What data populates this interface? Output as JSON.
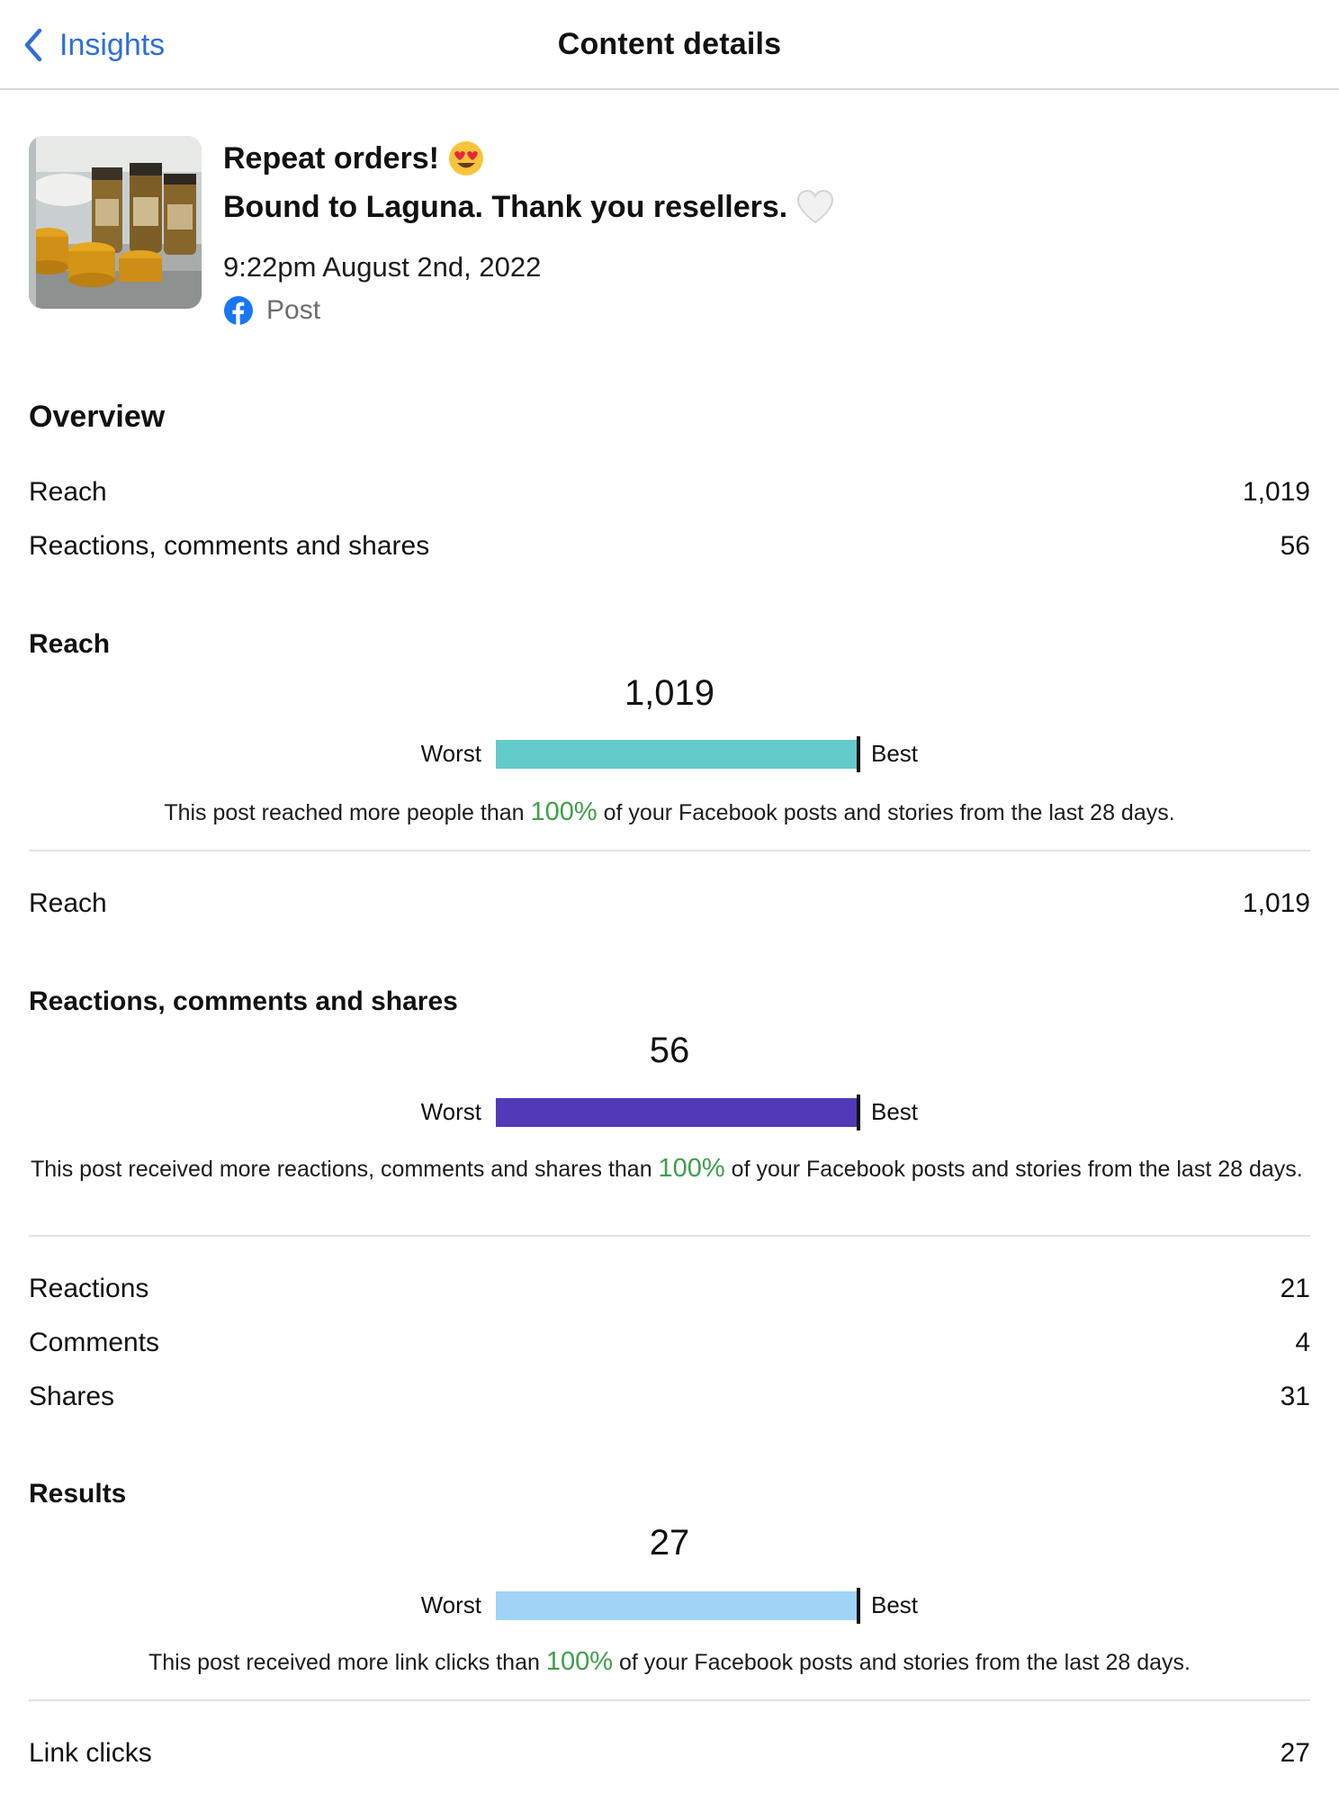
{
  "nav": {
    "back_label": "Insights",
    "title": "Content details"
  },
  "post": {
    "title_line1": "Repeat orders!",
    "title_line2": "Bound to Laguna. Thank you resellers.",
    "timestamp": "9:22pm August 2nd, 2022",
    "type": "Post",
    "brand_color": "#1877f2"
  },
  "overview": {
    "title": "Overview",
    "rows": [
      {
        "label": "Reach",
        "value": "1,019"
      },
      {
        "label": "Reactions, comments and shares",
        "value": "56"
      }
    ]
  },
  "reach": {
    "title": "Reach",
    "value": "1,019",
    "worst_label": "Worst",
    "best_label": "Best",
    "bar_color": "#63cbc9",
    "percentile": 100,
    "desc_before": "This post reached more people than ",
    "desc_pct": "100%",
    "desc_after": " of your Facebook posts and stories from the last 28 days.",
    "rows": [
      {
        "label": "Reach",
        "value": "1,019"
      }
    ]
  },
  "engagement": {
    "title": "Reactions, comments and shares",
    "value": "56",
    "worst_label": "Worst",
    "best_label": "Best",
    "bar_color": "#5239b8",
    "percentile": 100,
    "desc_before": "This post received more reactions, comments and shares than ",
    "desc_pct": "100%",
    "desc_after": " of your Facebook posts and stories from the last 28 days.",
    "rows": [
      {
        "label": "Reactions",
        "value": "21"
      },
      {
        "label": "Comments",
        "value": "4"
      },
      {
        "label": "Shares",
        "value": "31"
      }
    ]
  },
  "results": {
    "title": "Results",
    "value": "27",
    "worst_label": "Worst",
    "best_label": "Best",
    "bar_color": "#9fd4f7",
    "percentile": 100,
    "desc_before": "This post received more link clicks than ",
    "desc_pct": "100%",
    "desc_after": " of your Facebook posts and stories from the last 28 days.",
    "rows": [
      {
        "label": "Link clicks",
        "value": "27"
      }
    ]
  }
}
